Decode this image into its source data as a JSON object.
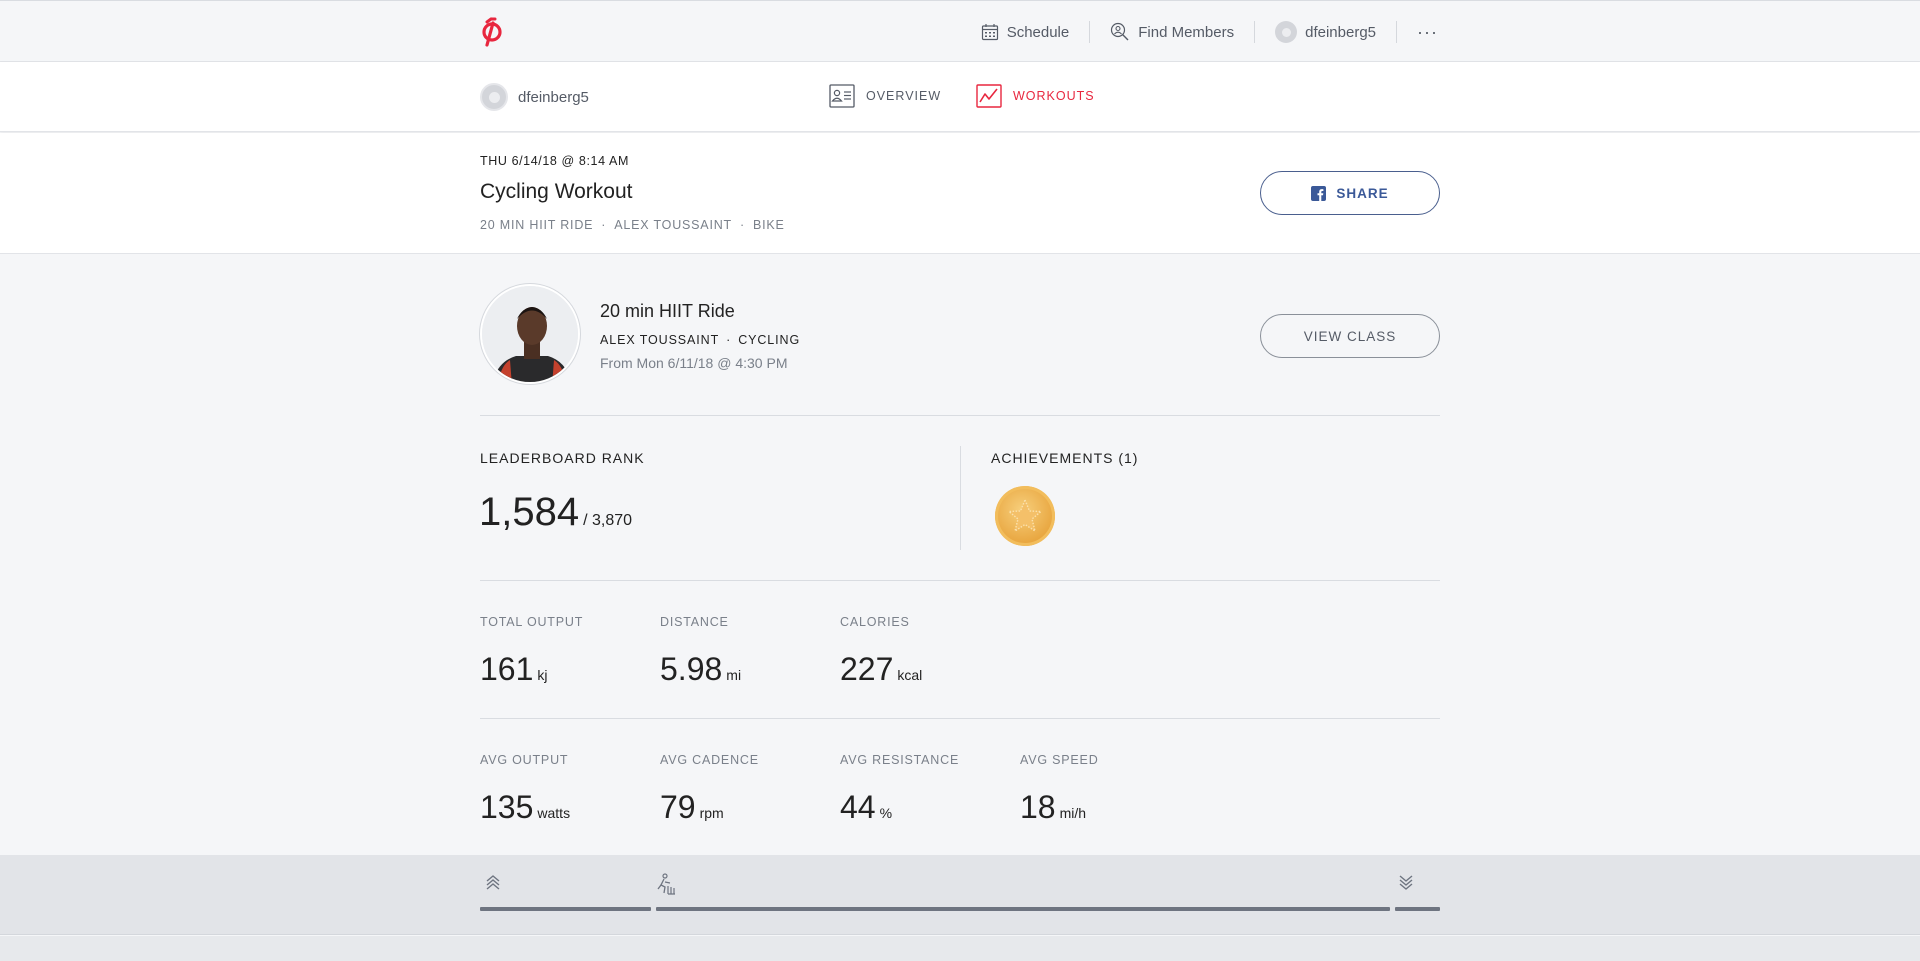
{
  "nav": {
    "schedule": "Schedule",
    "find_members": "Find Members",
    "username": "dfeinberg5",
    "more": "···"
  },
  "subnav": {
    "username": "dfeinberg5",
    "tabs": [
      {
        "label": "OVERVIEW",
        "active": false
      },
      {
        "label": "WORKOUTS",
        "active": true
      }
    ]
  },
  "workout": {
    "date": "THU 6/14/18 @ 8:14 AM",
    "title": "Cycling Workout",
    "meta": [
      "20 MIN HIIT RIDE",
      "ALEX TOUSSAINT",
      "BIKE"
    ],
    "share_label": "SHARE"
  },
  "class": {
    "name": "20 min HIIT Ride",
    "instructor": "ALEX TOUSSAINT",
    "discipline": "CYCLING",
    "from": "From Mon 6/11/18 @ 4:30 PM",
    "view_label": "VIEW CLASS"
  },
  "leaderboard": {
    "label": "LEADERBOARD RANK",
    "rank": "1,584",
    "total": "/ 3,870"
  },
  "achievements": {
    "label": "ACHIEVEMENTS (1)",
    "count": 1
  },
  "stats_row1": [
    {
      "label": "TOTAL OUTPUT",
      "value": "161",
      "unit": "kj"
    },
    {
      "label": "DISTANCE",
      "value": "5.98",
      "unit": "mi"
    },
    {
      "label": "CALORIES",
      "value": "227",
      "unit": "kcal"
    }
  ],
  "stats_row2": [
    {
      "label": "AVG OUTPUT",
      "value": "135",
      "unit": "watts"
    },
    {
      "label": "AVG CADENCE",
      "value": "79",
      "unit": "rpm"
    },
    {
      "label": "AVG RESISTANCE",
      "value": "44",
      "unit": "%"
    },
    {
      "label": "AVG SPEED",
      "value": "18",
      "unit": "mi/h"
    }
  ],
  "colors": {
    "brand": "#e8273f",
    "facebook": "#3b5998",
    "medal": "#e8a53e"
  }
}
